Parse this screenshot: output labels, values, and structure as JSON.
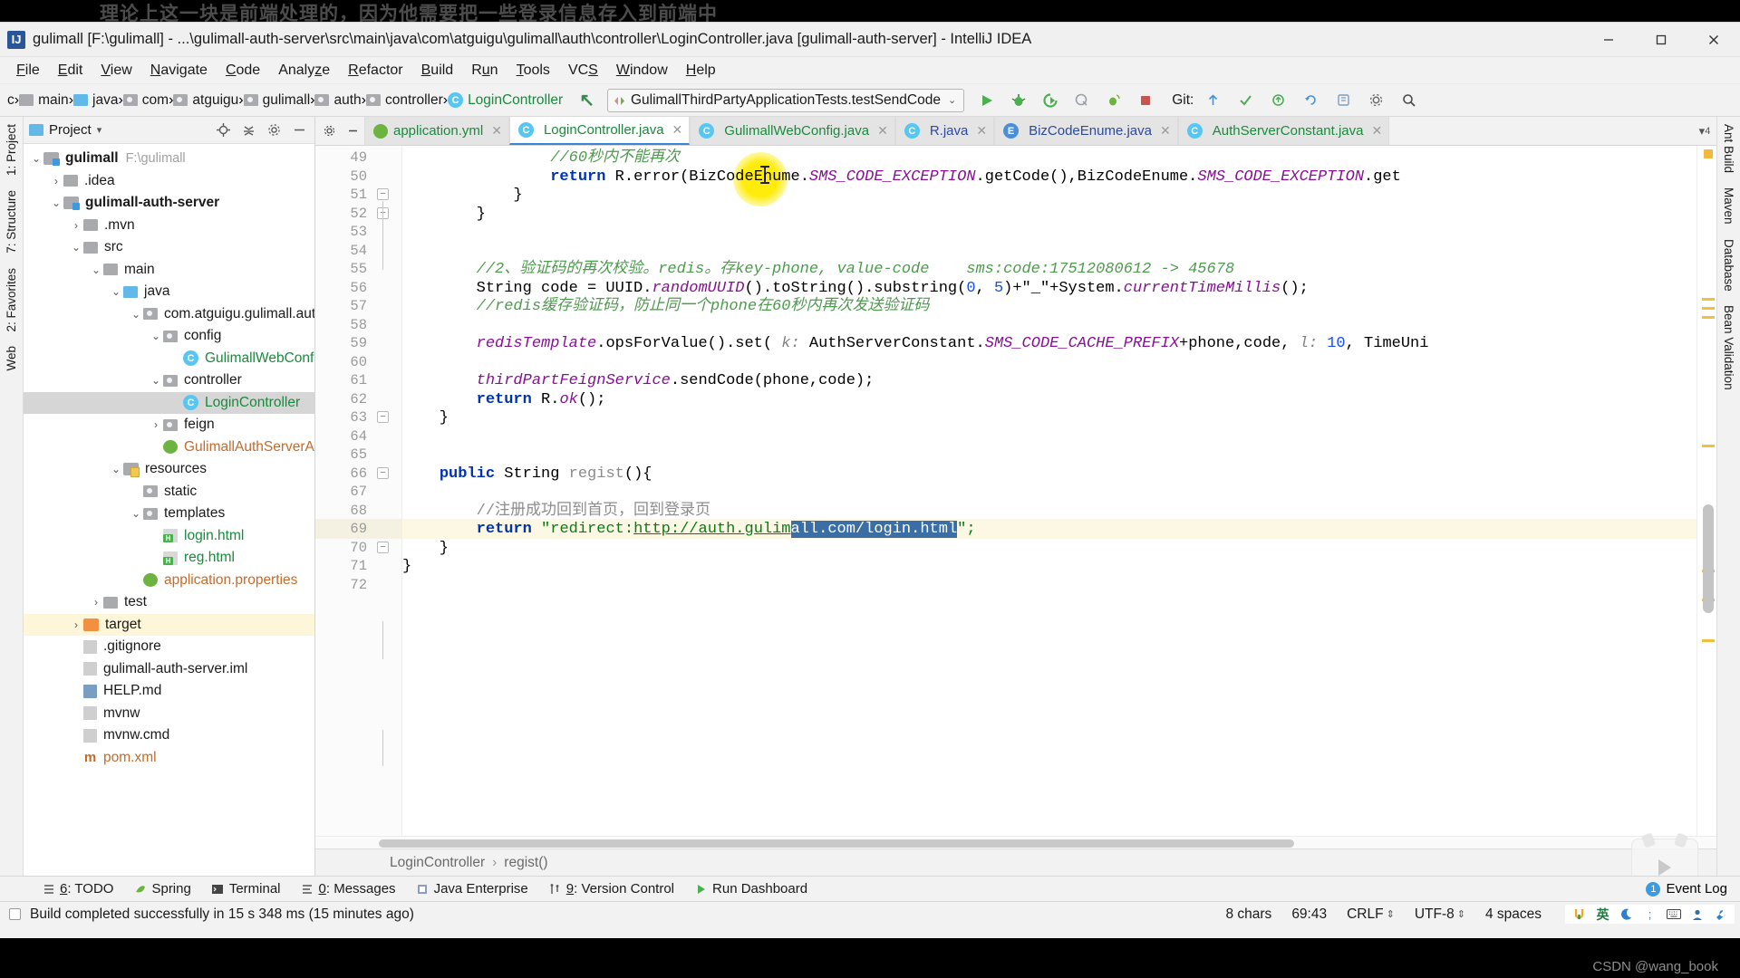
{
  "overlay_subtitle": "理论上这一块是前端处理的，因为他需要把一些登录信息存入到前端中",
  "window": {
    "title": "gulimall [F:\\gulimall] - ...\\gulimall-auth-server\\src\\main\\java\\com\\atguigu\\gulimall\\auth\\controller\\LoginController.java [gulimall-auth-server] - IntelliJ IDEA",
    "minimize": "−",
    "maximize": "□",
    "close": "✕"
  },
  "menu": [
    {
      "label": "File",
      "mnemonic": "F"
    },
    {
      "label": "Edit",
      "mnemonic": "E"
    },
    {
      "label": "View",
      "mnemonic": "V"
    },
    {
      "label": "Navigate",
      "mnemonic": "N"
    },
    {
      "label": "Code",
      "mnemonic": "C"
    },
    {
      "label": "Analyze",
      "mnemonic": "z"
    },
    {
      "label": "Refactor",
      "mnemonic": "R"
    },
    {
      "label": "Build",
      "mnemonic": "B"
    },
    {
      "label": "Run",
      "mnemonic": "u"
    },
    {
      "label": "Tools",
      "mnemonic": "T"
    },
    {
      "label": "VCS",
      "mnemonic": "S"
    },
    {
      "label": "Window",
      "mnemonic": "W"
    },
    {
      "label": "Help",
      "mnemonic": "H"
    }
  ],
  "breadcrumb_top": [
    "c",
    "main",
    "java",
    "com",
    "atguigu",
    "gulimall",
    "auth",
    "controller",
    "LoginController"
  ],
  "run_config": {
    "name": "GulimallThirdPartyApplicationTests.testSendCode",
    "caret": "⌄"
  },
  "git_label": "Git:",
  "project_panel": {
    "title": "Project",
    "caret": "▾",
    "tree": [
      {
        "depth": 0,
        "twist": "⌄",
        "label": "gulimall",
        "path": "F:\\gulimall",
        "icon": "module",
        "bold": true
      },
      {
        "depth": 1,
        "twist": "›",
        "label": ".idea",
        "icon": "folder"
      },
      {
        "depth": 1,
        "twist": "⌄",
        "label": "gulimall-auth-server",
        "icon": "module",
        "bold": true
      },
      {
        "depth": 2,
        "twist": "›",
        "label": ".mvn",
        "icon": "folder"
      },
      {
        "depth": 2,
        "twist": "⌄",
        "label": "src",
        "icon": "folder"
      },
      {
        "depth": 3,
        "twist": "⌄",
        "label": "main",
        "icon": "folder"
      },
      {
        "depth": 4,
        "twist": "⌄",
        "label": "java",
        "icon": "folder-blue"
      },
      {
        "depth": 5,
        "twist": "⌄",
        "label": "com.atguigu.gulimall.aut",
        "icon": "package"
      },
      {
        "depth": 6,
        "twist": "⌄",
        "label": "config",
        "icon": "package"
      },
      {
        "depth": 7,
        "twist": "",
        "label": "GulimallWebConf",
        "icon": "class",
        "color": "green"
      },
      {
        "depth": 6,
        "twist": "⌄",
        "label": "controller",
        "icon": "package"
      },
      {
        "depth": 7,
        "twist": "",
        "label": "LoginController",
        "icon": "class",
        "color": "green",
        "selected": true
      },
      {
        "depth": 6,
        "twist": "›",
        "label": "feign",
        "icon": "package"
      },
      {
        "depth": 6,
        "twist": "",
        "label": "GulimallAuthServerAp",
        "icon": "spring",
        "color": "orange"
      },
      {
        "depth": 4,
        "twist": "⌄",
        "label": "resources",
        "icon": "resources"
      },
      {
        "depth": 5,
        "twist": "",
        "label": "static",
        "icon": "package"
      },
      {
        "depth": 5,
        "twist": "⌄",
        "label": "templates",
        "icon": "package"
      },
      {
        "depth": 6,
        "twist": "",
        "label": "login.html",
        "icon": "html",
        "color": "green"
      },
      {
        "depth": 6,
        "twist": "",
        "label": "reg.html",
        "icon": "html",
        "color": "green"
      },
      {
        "depth": 5,
        "twist": "",
        "label": "application.properties",
        "icon": "spring",
        "color": "orange"
      },
      {
        "depth": 3,
        "twist": "›",
        "label": "test",
        "icon": "folder"
      },
      {
        "depth": 2,
        "twist": "›",
        "label": "target",
        "icon": "folder-orange",
        "highlight": true
      },
      {
        "depth": 2,
        "twist": "",
        "label": ".gitignore",
        "icon": "file"
      },
      {
        "depth": 2,
        "twist": "",
        "label": "gulimall-auth-server.iml",
        "icon": "file"
      },
      {
        "depth": 2,
        "twist": "",
        "label": "HELP.md",
        "icon": "md"
      },
      {
        "depth": 2,
        "twist": "",
        "label": "mvnw",
        "icon": "file"
      },
      {
        "depth": 2,
        "twist": "",
        "label": "mvnw.cmd",
        "icon": "file"
      },
      {
        "depth": 2,
        "twist": "",
        "label": "pom.xml",
        "icon": "maven",
        "color": "orange"
      }
    ]
  },
  "editor_tabs": [
    {
      "label": "application.yml",
      "icon": "yml",
      "color": "green",
      "active": false
    },
    {
      "label": "LoginController.java",
      "icon": "class-c",
      "color": "green",
      "active": true
    },
    {
      "label": "GulimallWebConfig.java",
      "icon": "class-c",
      "color": "green",
      "active": false
    },
    {
      "label": "R.java",
      "icon": "class-c",
      "color": "blue",
      "active": false
    },
    {
      "label": "BizCodeEnume.java",
      "icon": "class-e",
      "color": "blue",
      "active": false
    },
    {
      "label": "AuthServerConstant.java",
      "icon": "class-c",
      "color": "green",
      "active": false
    }
  ],
  "code": {
    "first_line": 49,
    "lines": [
      {
        "n": 49,
        "segments": [
          {
            "t": "                //60秒内不能再次",
            "c": "cmt-g"
          }
        ]
      },
      {
        "n": 50,
        "segments": [
          {
            "t": "                "
          },
          {
            "t": "return",
            "c": "k"
          },
          {
            "t": " R."
          },
          {
            "t": "error",
            "c": "mth"
          },
          {
            "t": "(BizCodeEnume."
          },
          {
            "t": "SMS_CODE_EXCEPTION",
            "c": "stat"
          },
          {
            "t": ".getCode(),BizCodeEnume."
          },
          {
            "t": "SMS_CODE_EXCEPTION",
            "c": "stat"
          },
          {
            "t": ".get"
          }
        ]
      },
      {
        "n": 51,
        "segments": [
          {
            "t": "            }"
          }
        ],
        "fold": "−"
      },
      {
        "n": 52,
        "segments": [
          {
            "t": "        }"
          }
        ],
        "fold": "−"
      },
      {
        "n": 53,
        "segments": [
          {
            "t": ""
          }
        ]
      },
      {
        "n": 54,
        "segments": [
          {
            "t": ""
          }
        ]
      },
      {
        "n": 55,
        "segments": [
          {
            "t": "        //2、验证码的再次校验。redis。存key-phone, value-code    sms:code:17512080612 -> 45678",
            "c": "cmt-g"
          }
        ]
      },
      {
        "n": 56,
        "segments": [
          {
            "t": "        String code = UUID."
          },
          {
            "t": "randomUUID",
            "c": "fld"
          },
          {
            "t": "().toString().substring("
          },
          {
            "t": "0",
            "c": "num"
          },
          {
            "t": ", "
          },
          {
            "t": "5",
            "c": "num"
          },
          {
            "t": ")+\"_\"+System."
          },
          {
            "t": "currentTimeMillis",
            "c": "fld"
          },
          {
            "t": "();"
          }
        ]
      },
      {
        "n": 57,
        "segments": [
          {
            "t": "        //redis缓存验证码，防止同一个phone在60秒内再次发送验证码",
            "c": "cmt-g"
          }
        ]
      },
      {
        "n": 58,
        "segments": [
          {
            "t": ""
          }
        ]
      },
      {
        "n": 59,
        "segments": [
          {
            "t": "        "
          },
          {
            "t": "redisTemplate",
            "c": "fld"
          },
          {
            "t": ".opsForValue().set( "
          },
          {
            "t": "k:",
            "c": "param"
          },
          {
            "t": " AuthServerConstant."
          },
          {
            "t": "SMS_CODE_CACHE_PREFIX",
            "c": "stat"
          },
          {
            "t": "+phone,code, "
          },
          {
            "t": "l:",
            "c": "param"
          },
          {
            "t": " "
          },
          {
            "t": "10",
            "c": "num"
          },
          {
            "t": ", TimeUni"
          }
        ]
      },
      {
        "n": 60,
        "segments": [
          {
            "t": ""
          }
        ]
      },
      {
        "n": 61,
        "segments": [
          {
            "t": "        "
          },
          {
            "t": "thirdPartFeignService",
            "c": "fld"
          },
          {
            "t": ".sendCode(phone,code);"
          }
        ]
      },
      {
        "n": 62,
        "segments": [
          {
            "t": "        "
          },
          {
            "t": "return",
            "c": "k"
          },
          {
            "t": " R."
          },
          {
            "t": "ok",
            "c": "fld"
          },
          {
            "t": "();"
          }
        ]
      },
      {
        "n": 63,
        "segments": [
          {
            "t": "    }"
          }
        ],
        "fold": "−"
      },
      {
        "n": 64,
        "segments": [
          {
            "t": ""
          }
        ]
      },
      {
        "n": 65,
        "segments": [
          {
            "t": ""
          }
        ]
      },
      {
        "n": 66,
        "segments": [
          {
            "t": "    "
          },
          {
            "t": "public",
            "c": "k"
          },
          {
            "t": " String "
          },
          {
            "t": "regist",
            "c": "ident-grey"
          },
          {
            "t": "(){"
          }
        ],
        "fold": "−"
      },
      {
        "n": 67,
        "segments": [
          {
            "t": ""
          }
        ]
      },
      {
        "n": 68,
        "segments": [
          {
            "t": "        //注册成功回到首页，回到登录页",
            "c": "cmt"
          }
        ]
      },
      {
        "n": 69,
        "segments": [
          {
            "t": "        "
          },
          {
            "t": "return",
            "c": "k"
          },
          {
            "t": " "
          },
          {
            "t": "\"redirect:",
            "c": "str"
          },
          {
            "t": "http://auth.gulim",
            "c": "str link-u"
          },
          {
            "t": "all.com/login.html",
            "c": "sel"
          },
          {
            "t": "\";",
            "c": "str"
          }
        ],
        "current": true
      },
      {
        "n": 70,
        "segments": [
          {
            "t": "    }"
          }
        ],
        "fold": "−"
      },
      {
        "n": 71,
        "segments": [
          {
            "t": "}"
          }
        ]
      },
      {
        "n": 72,
        "segments": [
          {
            "t": ""
          }
        ]
      }
    ]
  },
  "bottom_breadcrumb": [
    "LoginController",
    "regist()"
  ],
  "left_rail": [
    "1: Project",
    "7: Structure",
    "2: Favorites",
    "Web"
  ],
  "right_rail": [
    "Ant Build",
    "Maven",
    "Database",
    "Bean Validation"
  ],
  "tool_windows": [
    {
      "label": "6: TODO",
      "mnemonic": "6",
      "icon": "todo-icon"
    },
    {
      "label": "Spring",
      "mnemonic": "",
      "icon": "spring-icon"
    },
    {
      "label": "Terminal",
      "mnemonic": "",
      "icon": "terminal-icon"
    },
    {
      "label": "0: Messages",
      "mnemonic": "0",
      "icon": "messages-icon"
    },
    {
      "label": "Java Enterprise",
      "mnemonic": "",
      "icon": "java-enterprise-icon"
    },
    {
      "label": "9: Version Control",
      "mnemonic": "9",
      "icon": "version-control-icon"
    },
    {
      "label": "Run Dashboard",
      "mnemonic": "",
      "icon": "run-dashboard-icon"
    }
  ],
  "event_log": {
    "label": "Event Log",
    "badge": "1"
  },
  "status": {
    "message": "Build completed successfully in 15 s 348 ms (15 minutes ago)",
    "chars": "8 chars",
    "caret_pos": "69:43",
    "line_sep": "CRLF",
    "encoding": "UTF-8",
    "indent": "4 spaces",
    "ime": [
      "英",
      "☽",
      "；",
      "⌨",
      "👤",
      "🔧"
    ]
  },
  "watermark": "CSDN @wang_book"
}
